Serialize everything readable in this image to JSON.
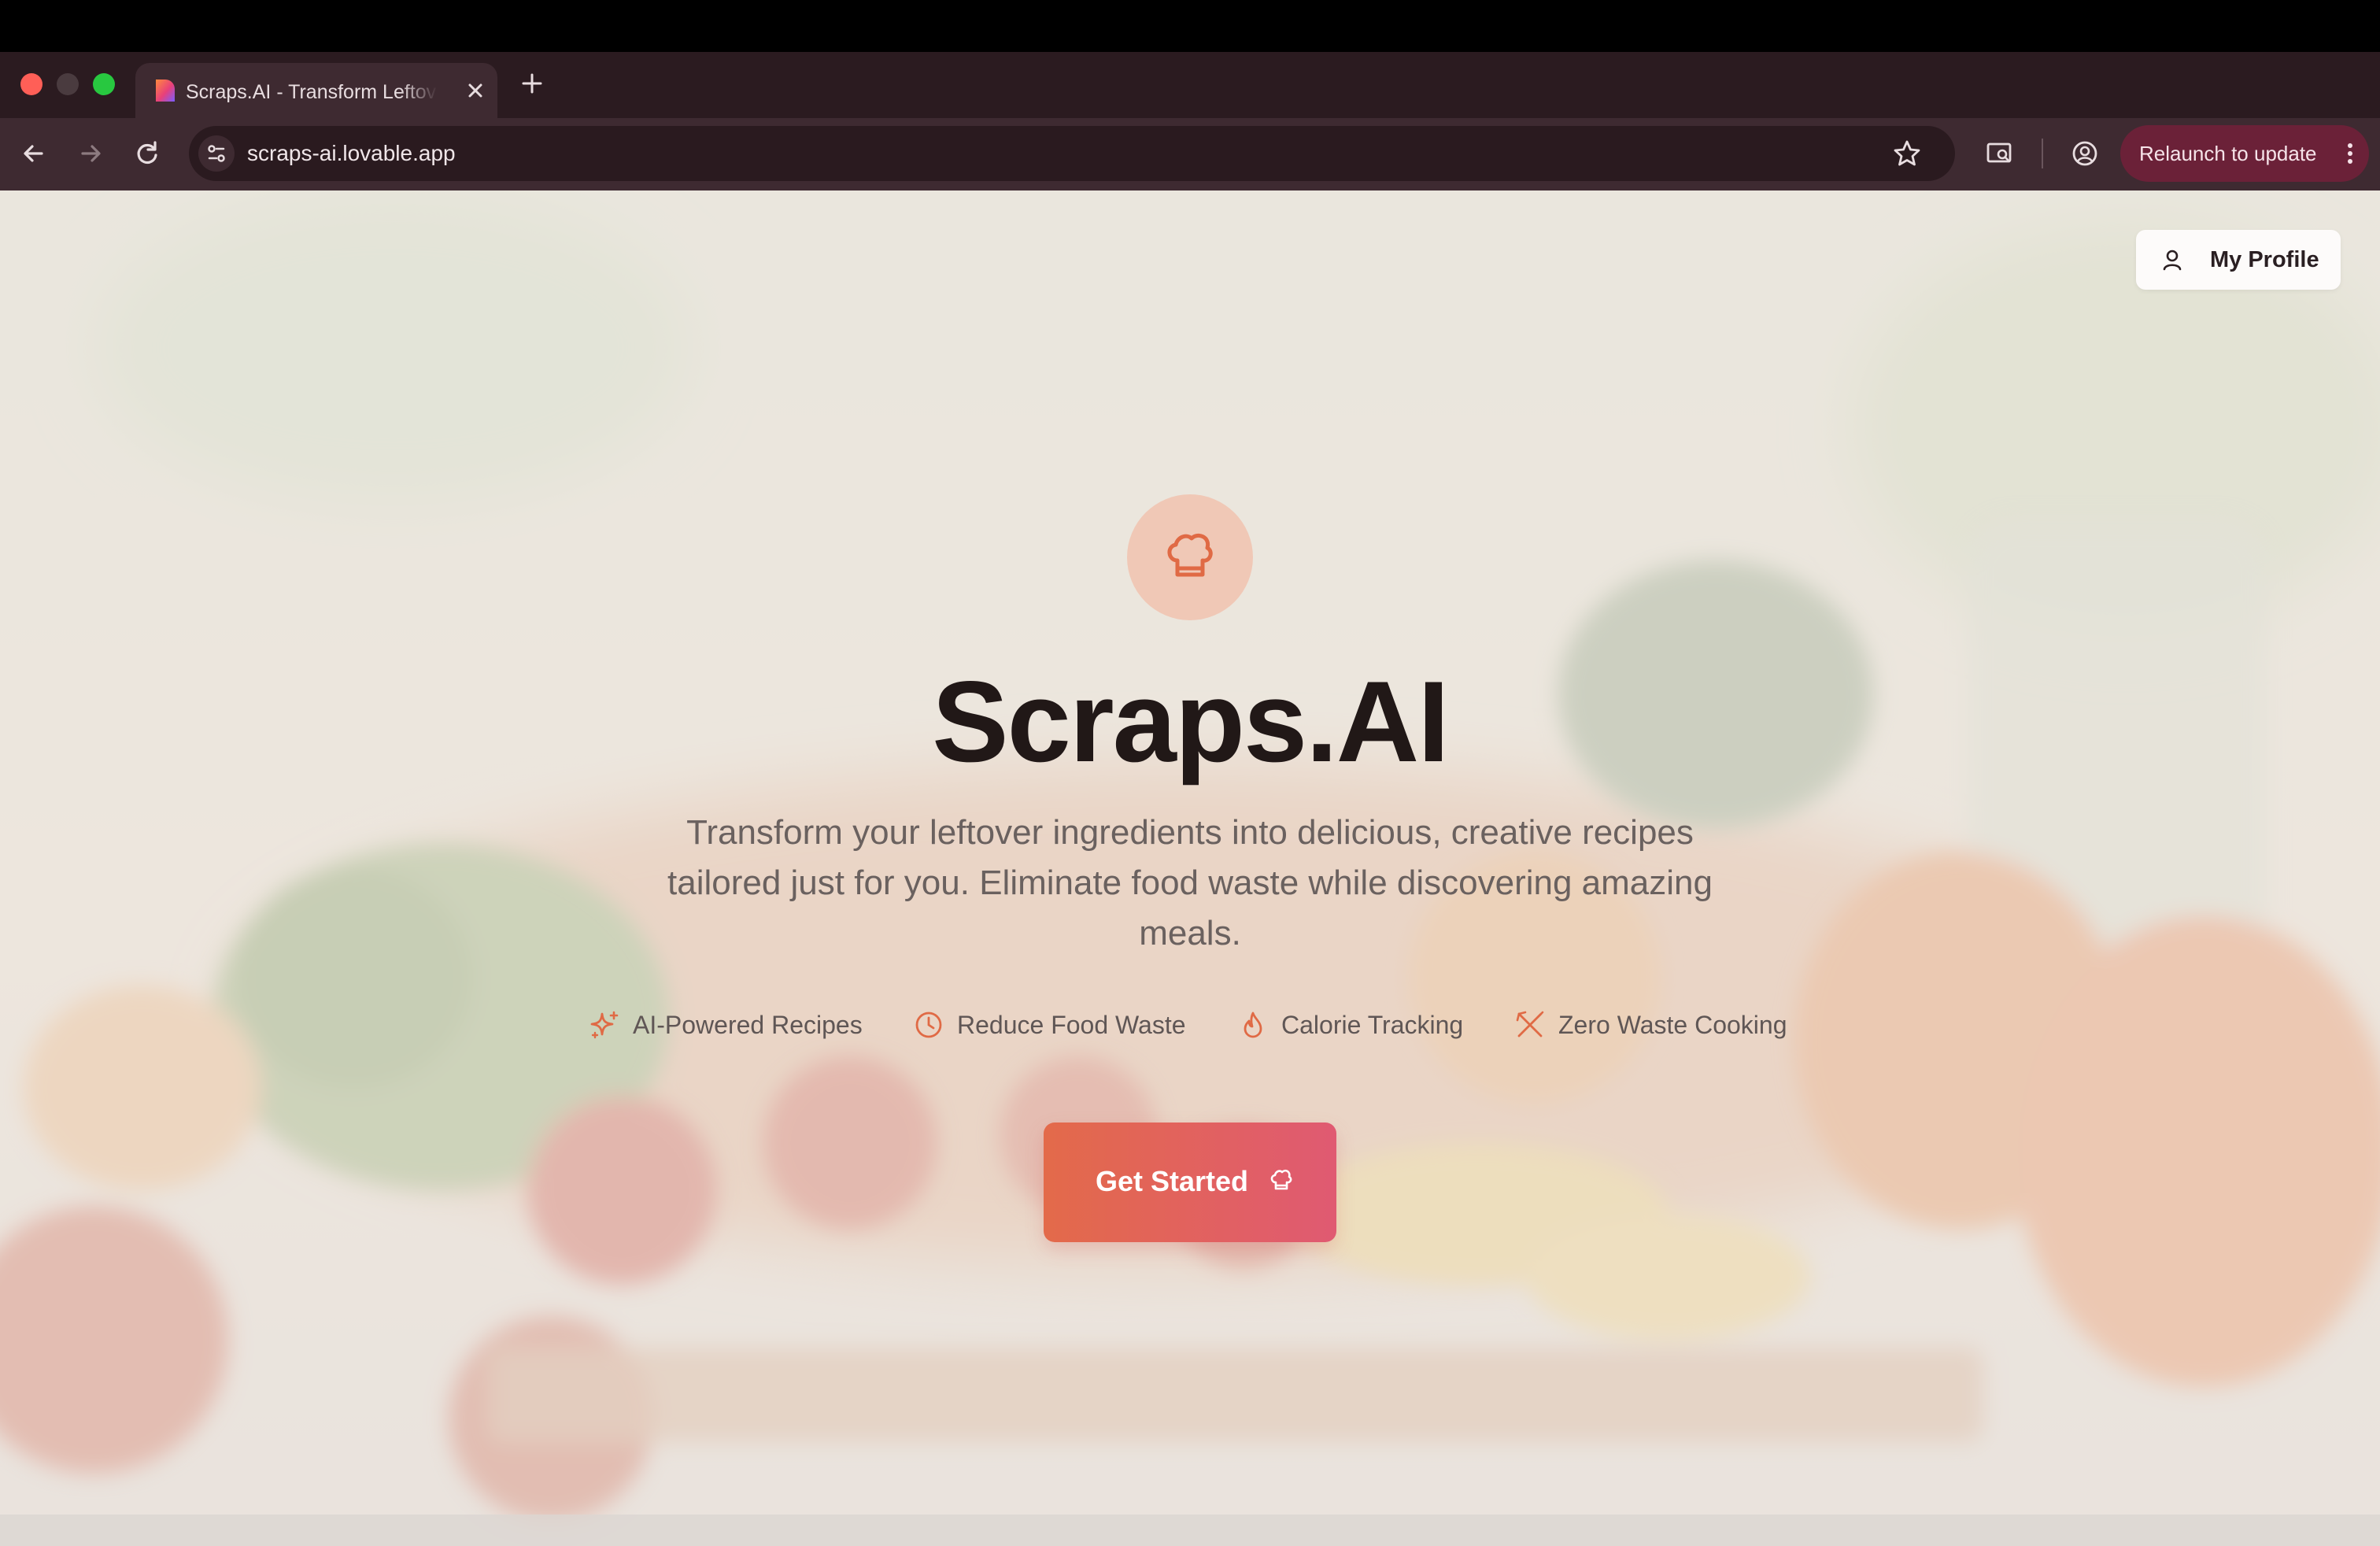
{
  "browser": {
    "tab": {
      "title": "Scraps.AI - Transform Leftovers"
    },
    "address": {
      "url": "scraps-ai.lovable.app"
    },
    "relaunch_label": "Relaunch to update",
    "accent": "#6b2138"
  },
  "header": {
    "profile_label": "My Profile"
  },
  "hero": {
    "title": "Scraps.AI",
    "subtitle": "Transform your leftover ingredients into delicious, creative recipes tailored just for you. Eliminate food waste while discovering amazing meals.",
    "logo_icon": "chef-hat-icon"
  },
  "features": [
    {
      "label": "AI-Powered Recipes",
      "icon": "sparkles-icon"
    },
    {
      "label": "Reduce Food Waste",
      "icon": "clock-icon"
    },
    {
      "label": "Calorie Tracking",
      "icon": "flame-icon"
    },
    {
      "label": "Zero Waste Cooking",
      "icon": "utensils-crossed-icon"
    }
  ],
  "cta": {
    "label": "Get Started",
    "icon": "chef-hat-icon"
  },
  "colors": {
    "brand_orange": "#e36a4a",
    "brand_pink": "#e05a72",
    "title": "#211817"
  }
}
